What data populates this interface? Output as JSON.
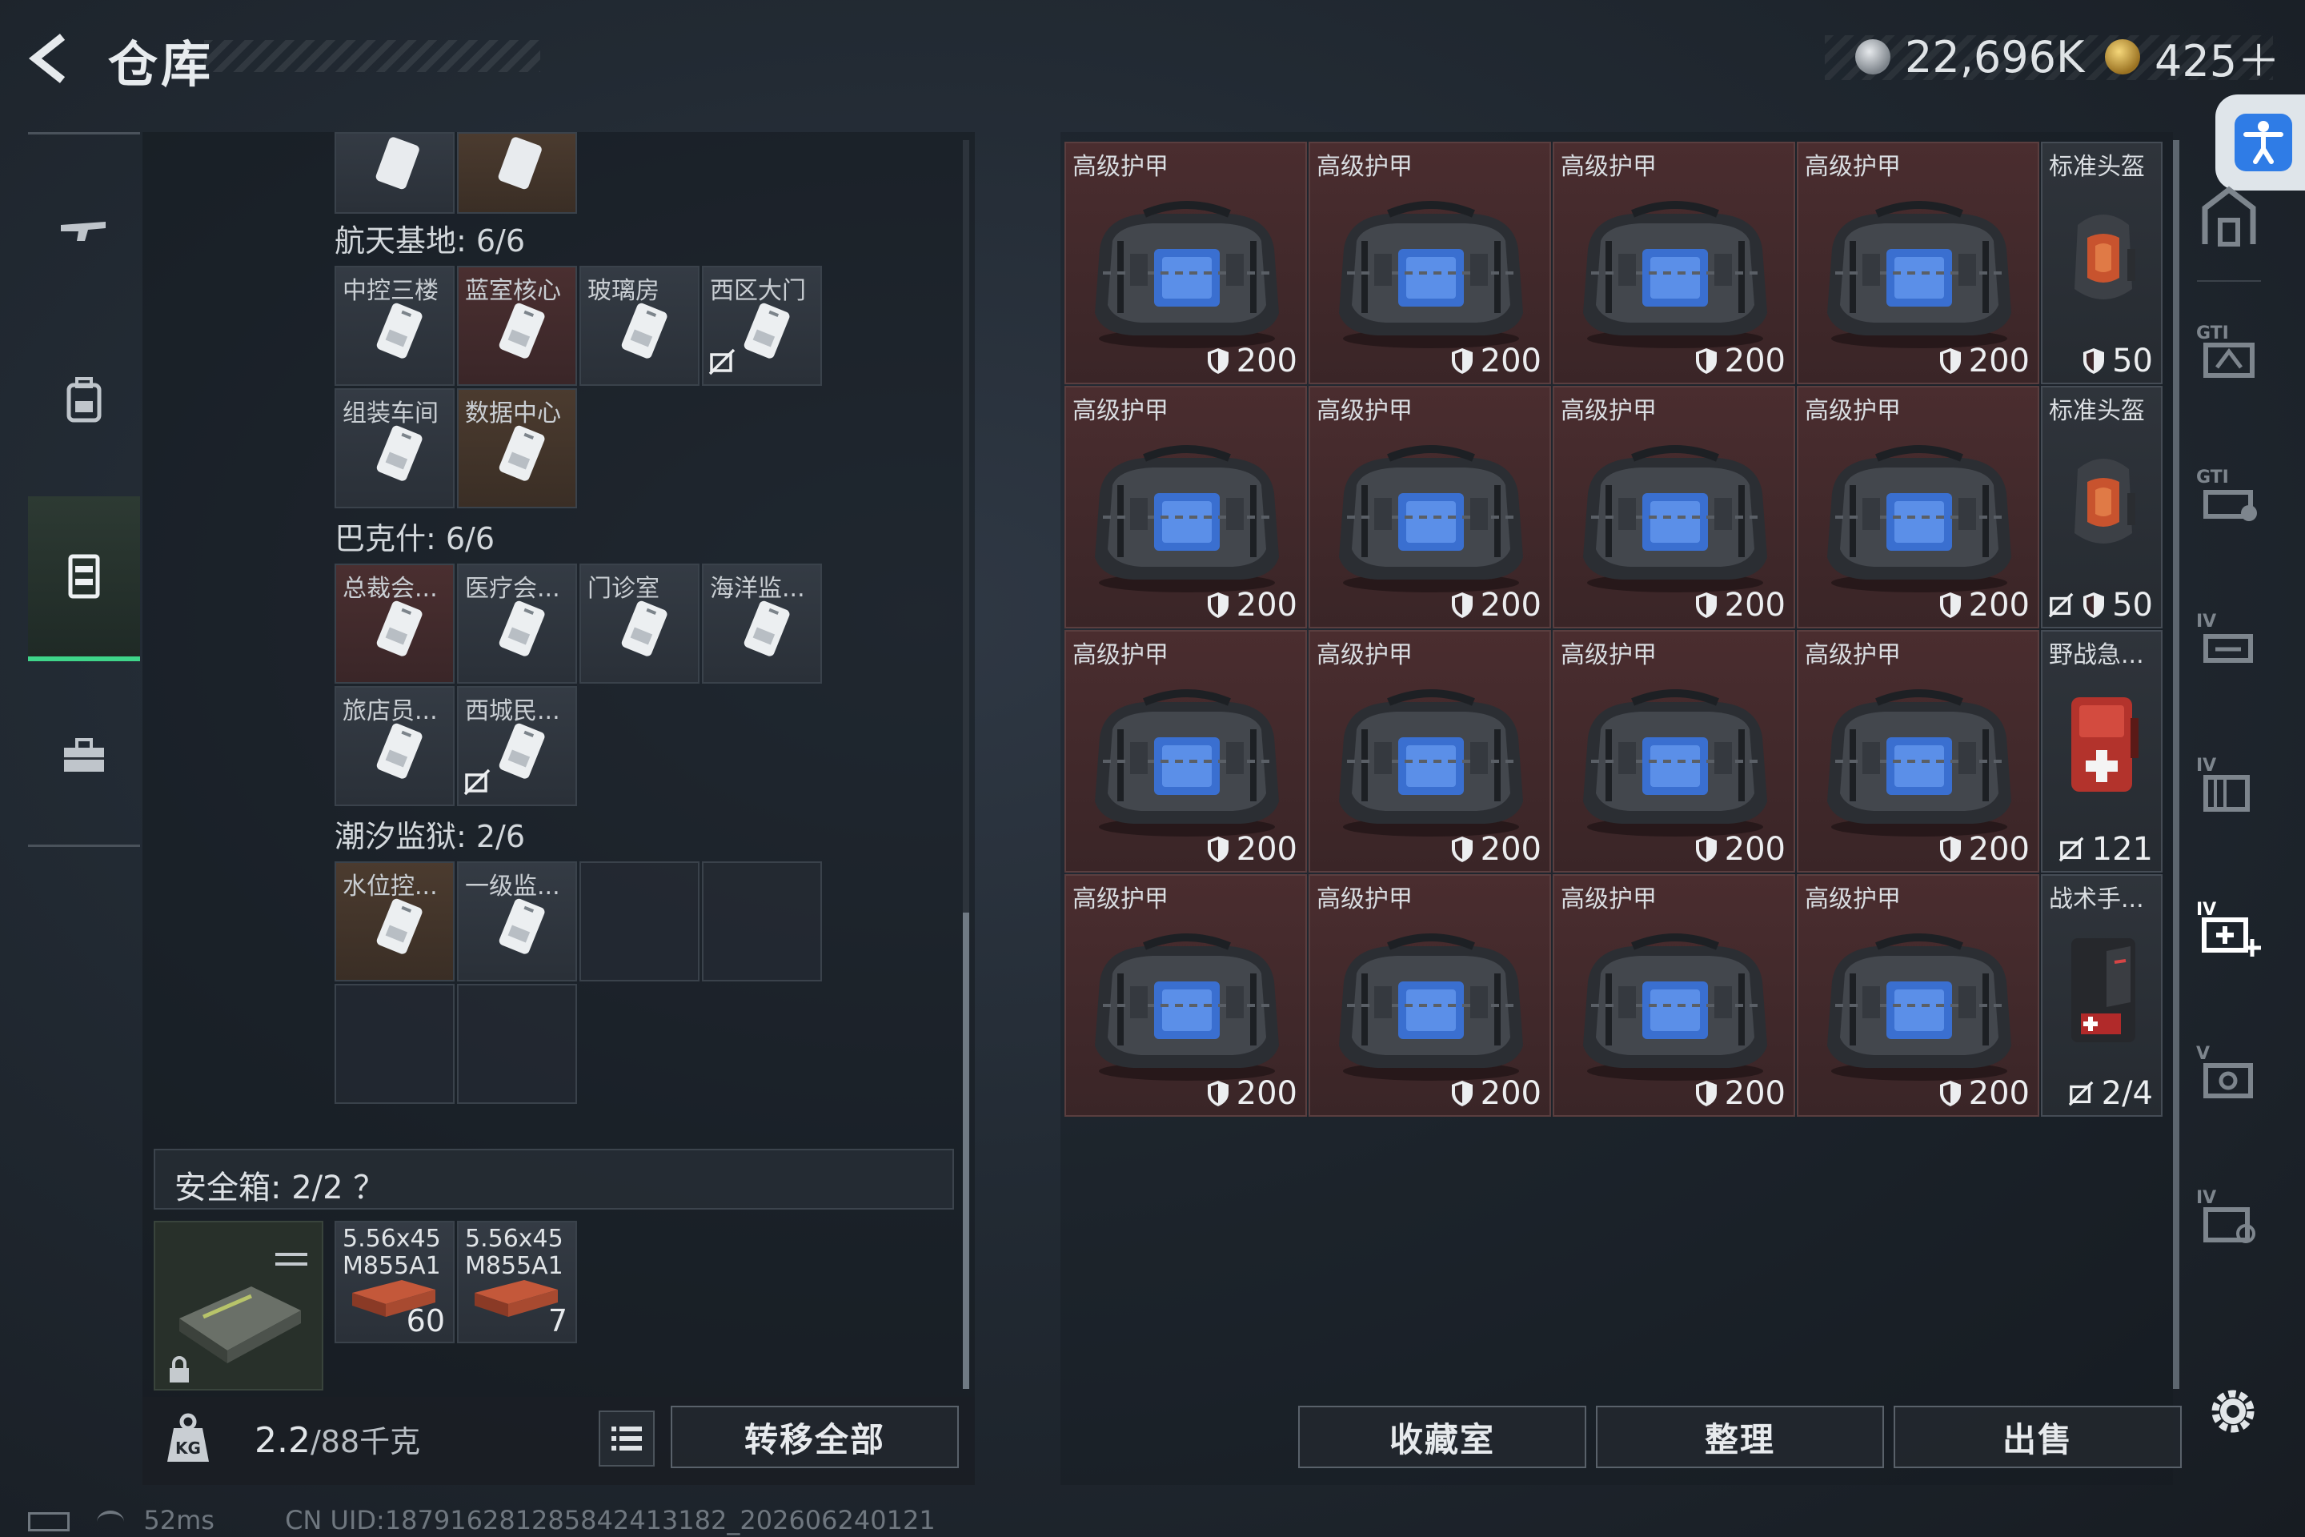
{
  "header": {
    "title": "仓库",
    "currency_silver": "22,696K",
    "currency_gold": "425＋"
  },
  "left_rail": [
    {
      "icon": "rifle-icon"
    },
    {
      "icon": "backpack-icon"
    },
    {
      "icon": "vest-icon",
      "active": true
    },
    {
      "icon": "toolbox-icon"
    }
  ],
  "key_groups": [
    {
      "title": "航天基地: 6/6",
      "slots": [
        {
          "label": "中控三楼",
          "tone": "grey"
        },
        {
          "label": "蓝室核心",
          "tone": "red"
        },
        {
          "label": "玻璃房",
          "tone": "grey"
        },
        {
          "label": "西区大门",
          "tone": "grey",
          "no_drop": true
        },
        {
          "label": "组装车间",
          "tone": "grey"
        },
        {
          "label": "数据中心",
          "tone": "brown"
        }
      ]
    },
    {
      "title": "巴克什: 6/6",
      "slots": [
        {
          "label": "总裁会...",
          "tone": "red"
        },
        {
          "label": "医疗会...",
          "tone": "grey"
        },
        {
          "label": "门诊室",
          "tone": "grey"
        },
        {
          "label": "海洋监...",
          "tone": "grey"
        },
        {
          "label": "旅店员...",
          "tone": "grey"
        },
        {
          "label": "西城民...",
          "tone": "grey",
          "no_drop": true
        }
      ]
    },
    {
      "title": "潮汐监狱: 2/6",
      "slots": [
        {
          "label": "水位控...",
          "tone": "brown"
        },
        {
          "label": "一级监...",
          "tone": "grey"
        }
      ]
    }
  ],
  "safe_box": {
    "title": "安全箱: 2/2 ？",
    "ammo": [
      {
        "name": "5.56x45\nM855A1",
        "count": "60"
      },
      {
        "name": "5.56x45\nM855A1",
        "count": "7"
      }
    ]
  },
  "bottom_left": {
    "weight": "2.2",
    "weight_max": "/88千克",
    "transfer_all": "转移全部"
  },
  "stash_rows": [
    [
      {
        "label": "高级护甲",
        "value": "200"
      },
      {
        "label": "高级护甲",
        "value": "200"
      },
      {
        "label": "高级护甲",
        "value": "200"
      },
      {
        "label": "高级护甲",
        "value": "200"
      },
      {
        "label": "标准头盔",
        "value": "50",
        "kind": "helmet"
      }
    ],
    [
      {
        "label": "高级护甲",
        "value": "200"
      },
      {
        "label": "高级护甲",
        "value": "200"
      },
      {
        "label": "高级护甲",
        "value": "200"
      },
      {
        "label": "高级护甲",
        "value": "200"
      },
      {
        "label": "标准头盔",
        "value": "50",
        "kind": "helmet",
        "no_drop": true
      }
    ],
    [
      {
        "label": "高级护甲",
        "value": "200"
      },
      {
        "label": "高级护甲",
        "value": "200"
      },
      {
        "label": "高级护甲",
        "value": "200"
      },
      {
        "label": "高级护甲",
        "value": "200"
      },
      {
        "label": "野战急...",
        "value": "121",
        "kind": "medkit",
        "no_drop": true
      }
    ],
    [
      {
        "label": "高级护甲",
        "value": "200"
      },
      {
        "label": "高级护甲",
        "value": "200"
      },
      {
        "label": "高级护甲",
        "value": "200"
      },
      {
        "label": "高级护甲",
        "value": "200"
      },
      {
        "label": "战术手...",
        "value": "2/4",
        "kind": "surgery",
        "no_drop": true
      }
    ]
  ],
  "bottom_right": {
    "collection": "收藏室",
    "sort": "整理",
    "sell": "出售"
  },
  "status_bar": {
    "ping": "52ms",
    "uid": "CN UID:187916281285842413182_202606240121"
  },
  "colors": {
    "accent_green": "#3fd58a",
    "armor_cell": "#4a2d2f",
    "accessibility_blue": "#2f7ce6"
  }
}
